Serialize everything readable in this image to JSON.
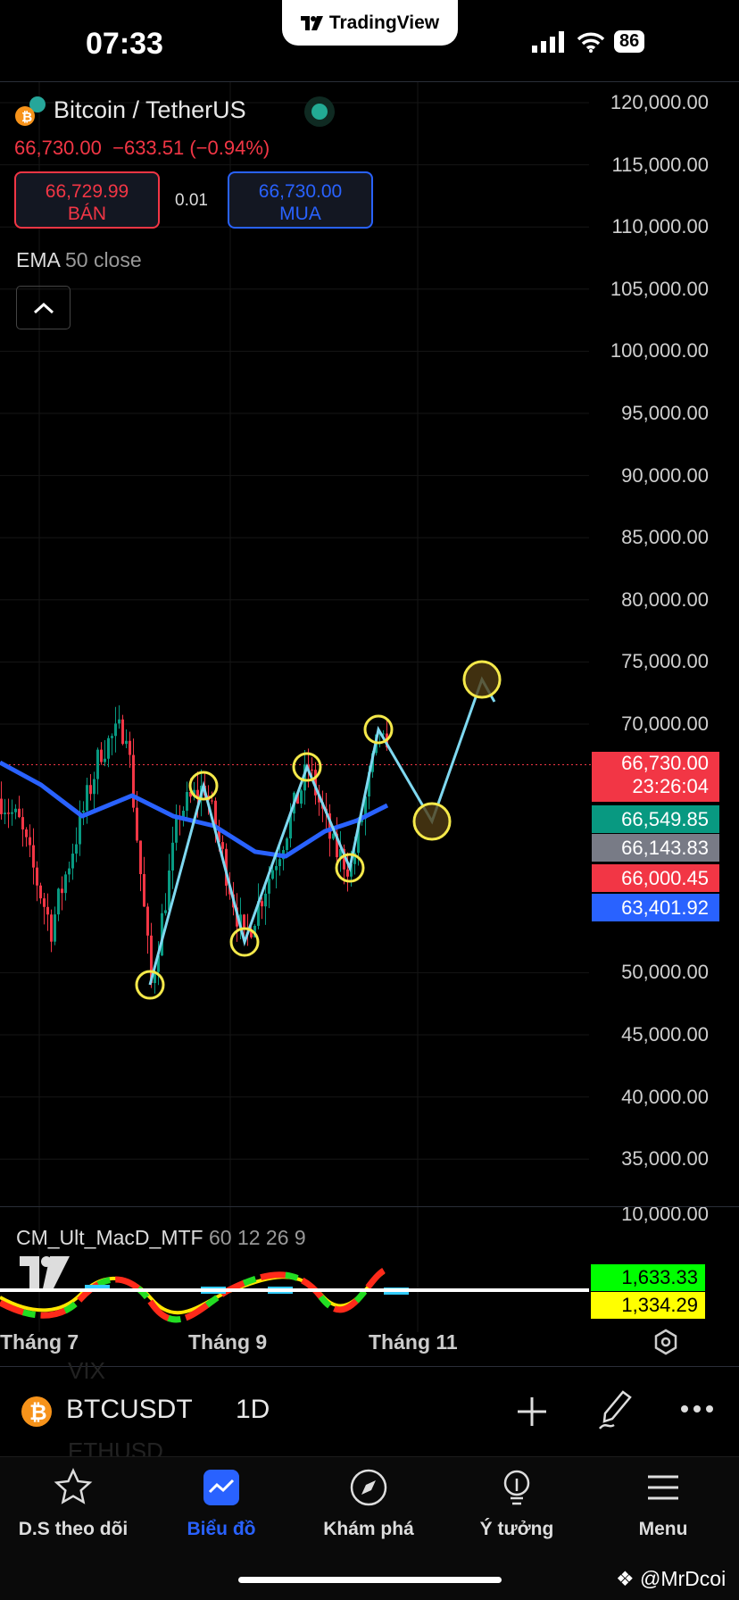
{
  "status_bar": {
    "time": "07:33",
    "battery": "86"
  },
  "app_pill": {
    "brand": "TradingView"
  },
  "header": {
    "symbol_title": "Bitcoin / TetherUS",
    "last_price": "66,730.00",
    "change": "−633.51 (−0.94%)"
  },
  "trade": {
    "sell_price": "66,729.99",
    "sell_label": "BÁN",
    "spread": "0.01",
    "buy_price": "66,730.00",
    "buy_label": "MUA"
  },
  "indicator": {
    "name": "EMA",
    "params": "50 close"
  },
  "price_axis": [
    "120,000.00",
    "115,000.00",
    "110,000.00",
    "105,000.00",
    "100,000.00",
    "95,000.00",
    "90,000.00",
    "85,000.00",
    "80,000.00",
    "75,000.00",
    "70,000.00",
    "50,000.00",
    "45,000.00",
    "40,000.00",
    "35,000.00",
    "10,000.00"
  ],
  "price_tags": [
    {
      "value": "66,730.00",
      "sub": "23:26:04",
      "color": "#f23645"
    },
    {
      "value": "66,549.85",
      "color": "#089981"
    },
    {
      "value": "66,143.83",
      "color": "#787b86"
    },
    {
      "value": "66,000.45",
      "color": "#f23645"
    },
    {
      "value": "63,401.92",
      "color": "#2962ff"
    }
  ],
  "macd": {
    "name": "CM_Ult_MacD_MTF",
    "params": "60 12 26 9",
    "value1": "1,633.33",
    "value2": "1,334.29"
  },
  "time_axis": [
    "Tháng 7",
    "Tháng 9",
    "Tháng 11"
  ],
  "ghost_list": [
    "VIX",
    "ETHUSD"
  ],
  "symbol_bar": {
    "symbol": "BTCUSDT",
    "interval": "1D"
  },
  "nav": [
    {
      "label": "D.S theo dõi",
      "icon": "star-icon"
    },
    {
      "label": "Biểu đồ",
      "icon": "chart-icon",
      "active": true
    },
    {
      "label": "Khám phá",
      "icon": "compass-icon"
    },
    {
      "label": "Ý tưởng",
      "icon": "lightbulb-icon"
    },
    {
      "label": "Menu",
      "icon": "menu-icon"
    }
  ],
  "watermark": "@MrDcoi",
  "chart_data": {
    "type": "candlestick",
    "price_range": [
      30000,
      120000
    ],
    "current_price": 66730,
    "path": [
      [
        0,
        64000
      ],
      [
        5,
        62000
      ],
      [
        14,
        53600
      ],
      [
        20,
        60000
      ],
      [
        28,
        68000
      ],
      [
        35,
        69900
      ],
      [
        42,
        49000
      ],
      [
        50,
        63000
      ],
      [
        57,
        65000
      ],
      [
        68,
        52500
      ],
      [
        78,
        60000
      ],
      [
        86,
        66500
      ],
      [
        93,
        60000
      ],
      [
        98,
        58400
      ],
      [
        106,
        69500
      ],
      [
        108,
        67000
      ]
    ],
    "ema": [
      [
        0,
        66910
      ],
      [
        11.5,
        65110
      ],
      [
        23,
        62600
      ],
      [
        37,
        64250
      ],
      [
        48.5,
        62600
      ],
      [
        60,
        61810
      ],
      [
        71.5,
        59730
      ],
      [
        80,
        59370
      ],
      [
        91,
        61380
      ],
      [
        100,
        62240
      ],
      [
        108.5,
        63460
      ]
    ],
    "wave": [
      [
        42,
        49020
      ],
      [
        57,
        65040
      ],
      [
        68.5,
        52470
      ],
      [
        86,
        66550
      ],
      [
        98,
        58430
      ],
      [
        106,
        69570
      ],
      [
        121,
        62170
      ],
      [
        135,
        73590
      ],
      [
        138.5,
        71800
      ]
    ],
    "circles": [
      [
        42,
        49020
      ],
      [
        57,
        65040
      ],
      [
        68.5,
        52470
      ],
      [
        86,
        66550
      ],
      [
        98,
        58430
      ],
      [
        106,
        69570
      ],
      [
        121,
        62170
      ],
      [
        135,
        73590
      ]
    ],
    "colors": {
      "up": "#089981",
      "down": "#f23645",
      "ema": "#2962ff",
      "wave": "#7fd8f0",
      "circle": "#f5e94a"
    }
  }
}
